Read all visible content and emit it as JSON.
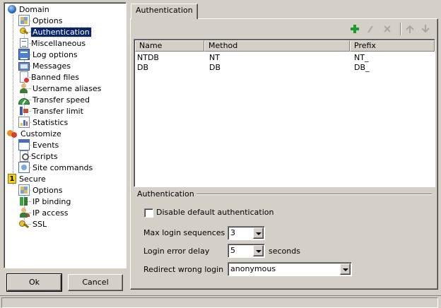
{
  "tree": {
    "items": [
      {
        "label": "Domain",
        "icon": "globe-icon"
      },
      {
        "label": "Options",
        "icon": "options-icon"
      },
      {
        "label": "Authentication",
        "icon": "keys-icon"
      },
      {
        "label": "Miscellaneous",
        "icon": "document-icon"
      },
      {
        "label": "Log options",
        "icon": "log-icon"
      },
      {
        "label": "Messages",
        "icon": "messages-icon"
      },
      {
        "label": "Banned files",
        "icon": "banned-file-icon"
      },
      {
        "label": "Username aliases",
        "icon": "user-icon"
      },
      {
        "label": "Transfer speed",
        "icon": "speedometer-icon"
      },
      {
        "label": "Transfer limit",
        "icon": "transfer-limit-icon"
      },
      {
        "label": "Statistics",
        "icon": "statistics-icon"
      },
      {
        "label": "Customize",
        "icon": "customize-icon"
      },
      {
        "label": "Events",
        "icon": "events-icon"
      },
      {
        "label": "Scripts",
        "icon": "scripts-icon"
      },
      {
        "label": "Site commands",
        "icon": "site-commands-icon"
      },
      {
        "label": "Secure",
        "icon": "secure-icon"
      },
      {
        "label": "Options",
        "icon": "options-icon"
      },
      {
        "label": "IP binding",
        "icon": "ip-binding-icon"
      },
      {
        "label": "IP access",
        "icon": "ip-access-icon"
      },
      {
        "label": "SSL",
        "icon": "ssl-key-icon"
      }
    ],
    "selected": "Authentication"
  },
  "buttons": {
    "ok": "Ok",
    "cancel": "Cancel"
  },
  "tab": {
    "label": "Authentication"
  },
  "toolbar": {
    "icons": [
      "add-icon",
      "edit-icon",
      "delete-icon",
      "move-up-icon",
      "move-down-icon"
    ]
  },
  "table": {
    "columns": [
      "Name",
      "Method",
      "Prefix"
    ],
    "rows": [
      [
        "NTDB",
        "NT",
        "NT_"
      ],
      [
        "DB",
        "DB",
        "DB_"
      ]
    ]
  },
  "group": {
    "title": "Authentication",
    "disable_default_label": "Disable default authentication",
    "disable_default_checked": false,
    "max_login_label": "Max login sequences",
    "max_login_value": "3",
    "login_delay_label": "Login error delay",
    "login_delay_value": "5",
    "login_delay_unit": "seconds",
    "redirect_label": "Redirect wrong login",
    "redirect_value": "anonymous"
  },
  "colors": {
    "selection": "#0a246a",
    "face": "#d4d0c8",
    "add_green": "#1e9b2e"
  }
}
